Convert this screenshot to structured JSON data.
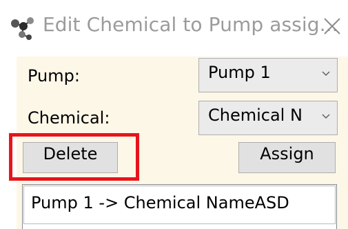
{
  "window": {
    "title": "Edit Chemical to Pump assig...",
    "app_icon": "molecule-icon",
    "close_icon": "close-icon"
  },
  "form": {
    "pump_label": "Pump:",
    "pump_value": "Pump 1",
    "chemical_label": "Chemical:",
    "chemical_value": "Chemical N",
    "dropdown_icon": "chevron-down-icon"
  },
  "buttons": {
    "delete_label": "Delete",
    "assign_label": "Assign"
  },
  "assignments": {
    "items": [
      {
        "label": "Pump 1 -> Chemical NameASD"
      }
    ]
  },
  "colors": {
    "client_background": "#fdf7e8",
    "highlight": "#e8141b",
    "title_text": "#9b9b9b"
  }
}
